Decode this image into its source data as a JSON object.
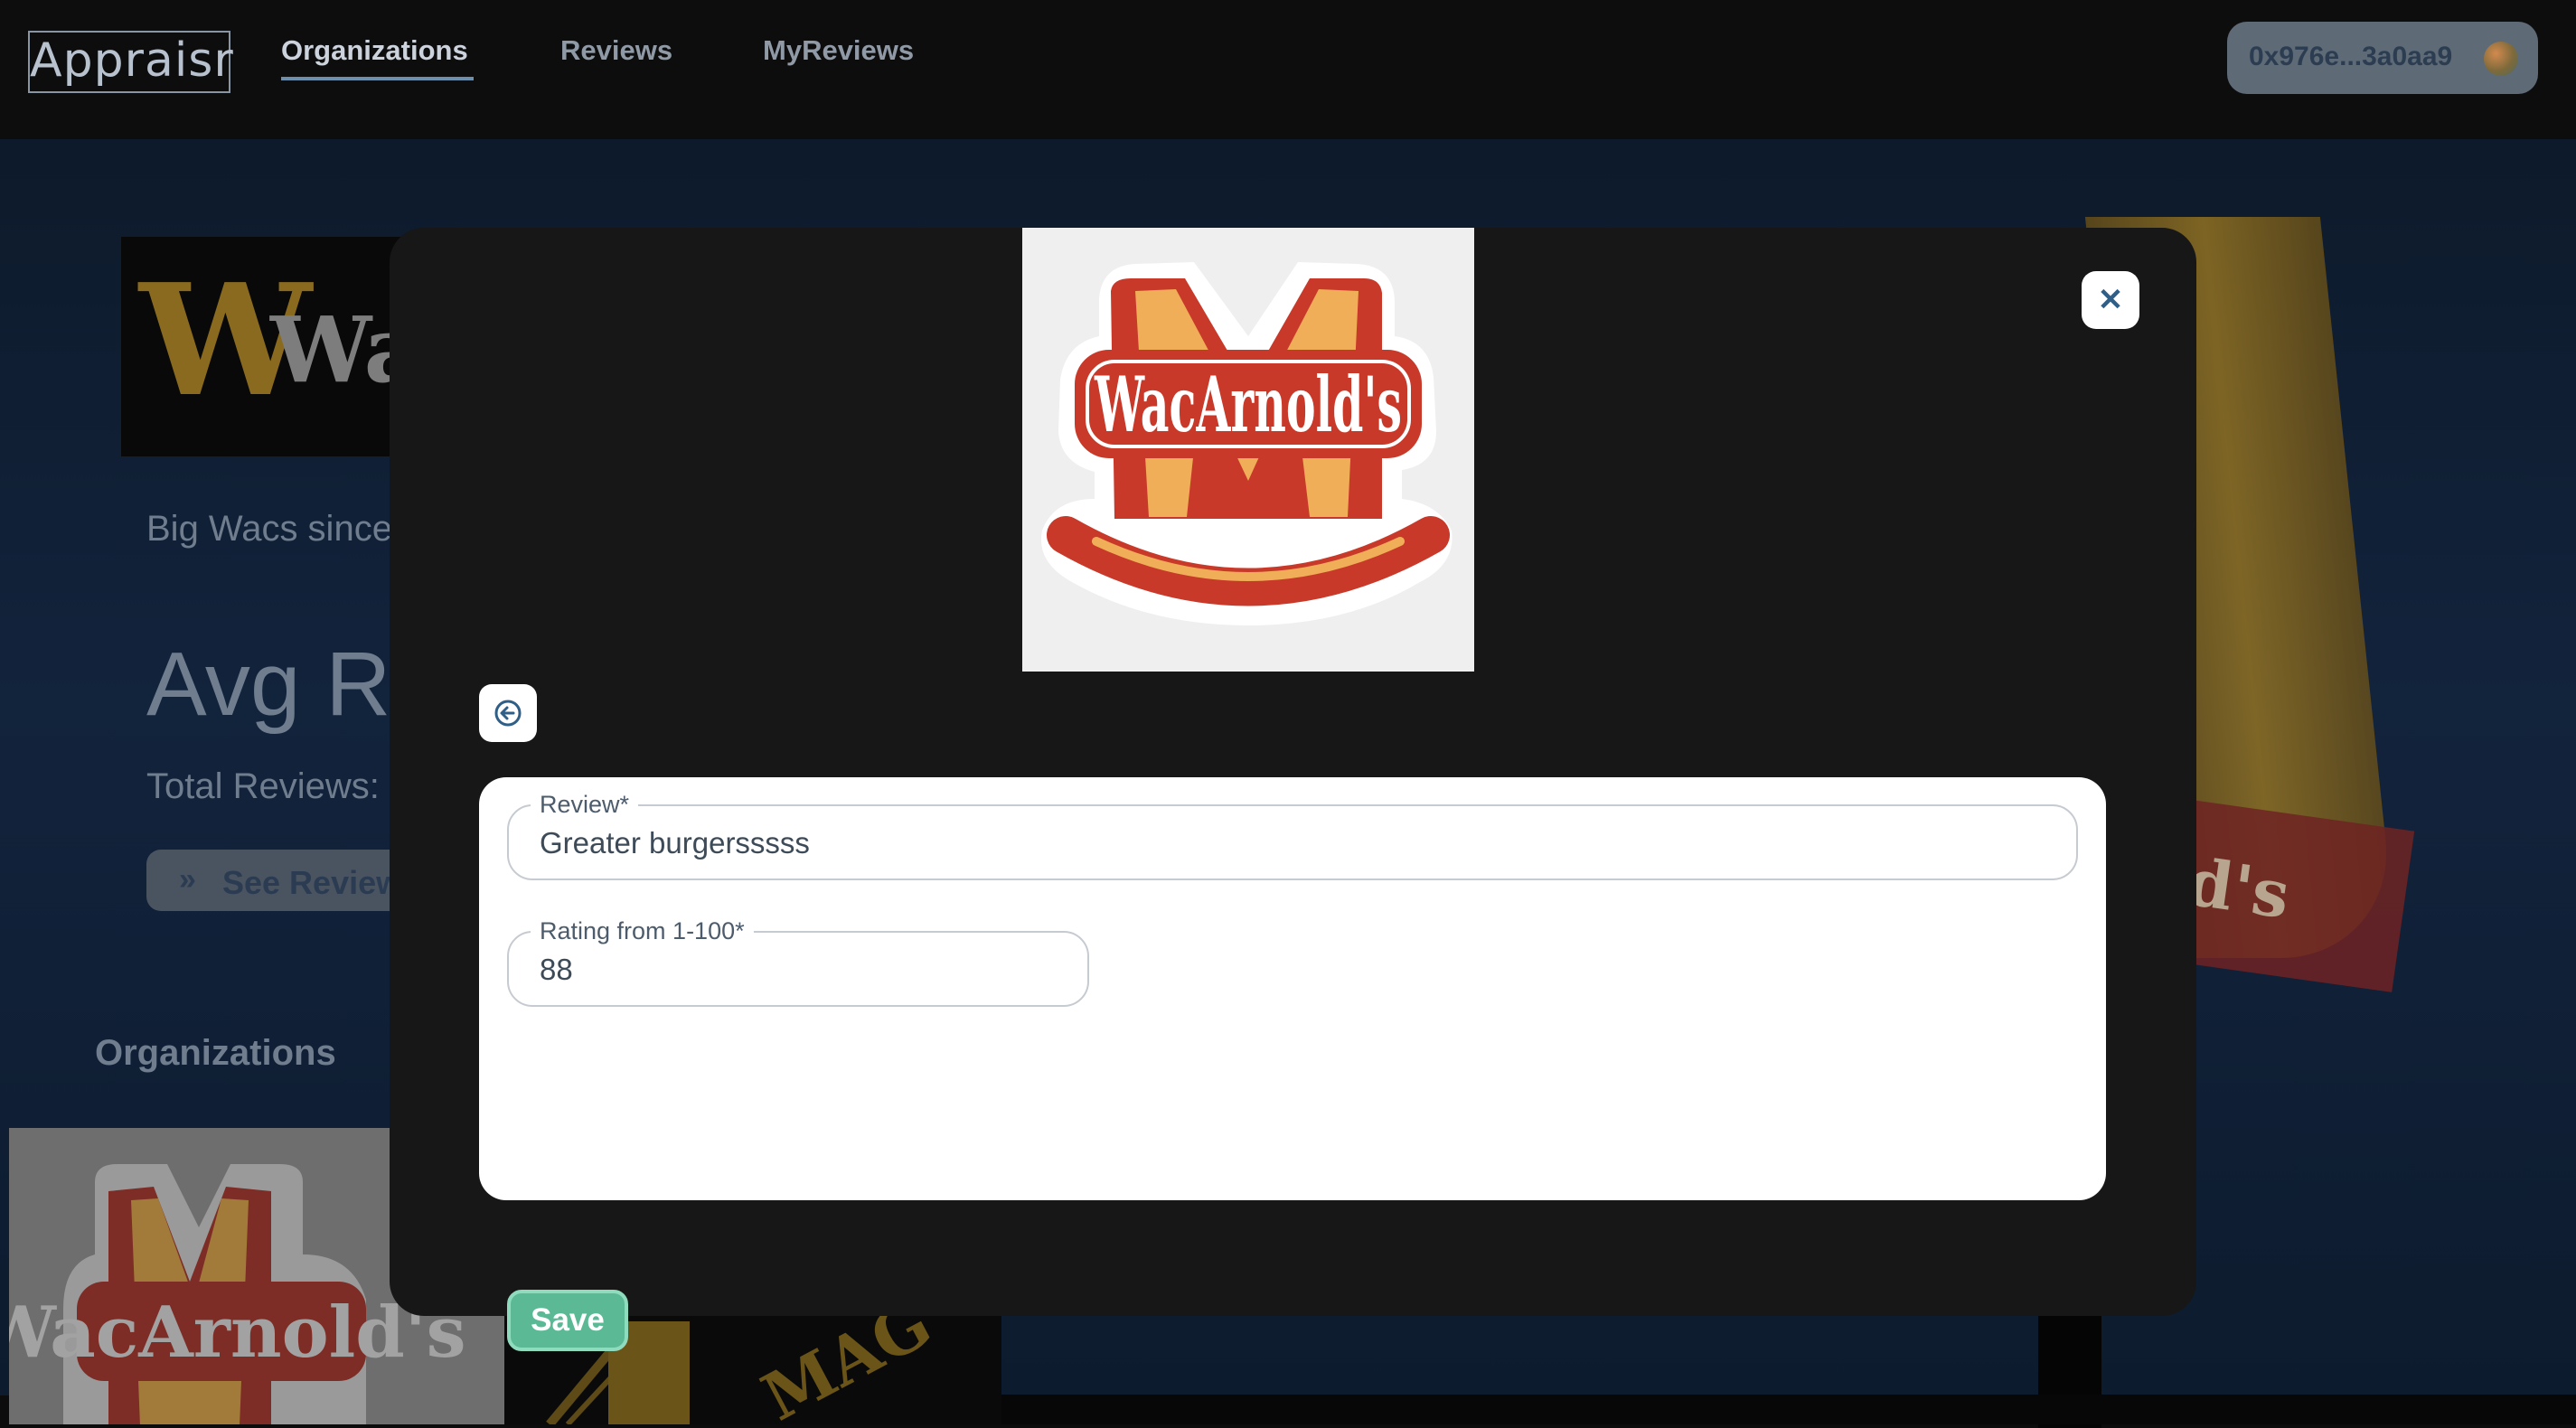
{
  "header": {
    "logo_text": "Appraisr",
    "nav": [
      {
        "label": "Organizations",
        "active": true
      },
      {
        "label": "Reviews",
        "active": false
      },
      {
        "label": "MyReviews",
        "active": false
      }
    ],
    "wallet_address": "0x976e...3a0aa9",
    "wallet_avatar_icon": "wallet-avatar-icon"
  },
  "background_page": {
    "org_banner_letter": "W",
    "org_banner_name": "Wac",
    "description": "Big Wacs since",
    "avg_rating_label": "Avg R",
    "total_reviews_label": "Total Reviews:",
    "see_reviews_label": "See Review",
    "see_reviews_icon": "double-chevron-right-icon",
    "organizations_heading": "Organizations",
    "sign_text": "d's",
    "card2_text": "MAG"
  },
  "modal": {
    "logo_wordmark": "WacArnold's",
    "close_icon": "close-icon",
    "back_icon": "arrow-left-circle-icon",
    "review_field": {
      "label": "Review*",
      "value": "Greater burgersssss"
    },
    "rating_field": {
      "label": "Rating from 1-100*",
      "value": "88"
    },
    "save_label": "Save"
  },
  "colors": {
    "modal_background": "#171717",
    "save_button": "#5bb996",
    "nav_accent": "#6d8fae",
    "logo_red": "#c8392a",
    "logo_orange": "#f0ae58"
  }
}
